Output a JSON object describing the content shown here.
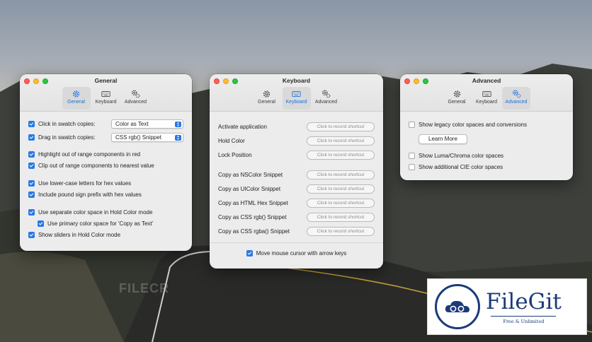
{
  "windows": {
    "general": {
      "title": "General",
      "tabs": [
        {
          "label": "General",
          "icon": "gear-icon",
          "active": true
        },
        {
          "label": "Keyboard",
          "icon": "keyboard-icon",
          "active": false
        },
        {
          "label": "Advanced",
          "icon": "gears-icon",
          "active": false
        }
      ],
      "click_copies_label": "Click in swatch copies:",
      "click_copies_value": "Color as Text",
      "drag_copies_label": "Drag in swatch copies:",
      "drag_copies_value": "CSS rgb() Snippet",
      "options": [
        {
          "label": "Highlight out of range components in red",
          "checked": true
        },
        {
          "label": "Clip out of range components to nearest value",
          "checked": true
        },
        {
          "label": "Use lower-case letters for hex values",
          "checked": true
        },
        {
          "label": "Include pound sign prefix with hex values",
          "checked": true
        },
        {
          "label": "Use separate color space in Hold Color mode",
          "checked": true
        },
        {
          "label": "Use primary color space for 'Copy as Text'",
          "checked": true
        },
        {
          "label": "Show sliders in Hold Color mode",
          "checked": true
        }
      ]
    },
    "keyboard": {
      "title": "Keyboard",
      "tabs": [
        {
          "label": "General",
          "icon": "gear-icon",
          "active": false
        },
        {
          "label": "Keyboard",
          "icon": "keyboard-icon",
          "active": true
        },
        {
          "label": "Advanced",
          "icon": "gears-icon",
          "active": false
        }
      ],
      "shortcut_placeholder": "Click to record shortcut",
      "shortcuts": [
        "Activate application",
        "Hold Color",
        "Lock Position",
        "Copy as NSColor Snippet",
        "Copy as UIColor Snippet",
        "Copy as HTML Hex Snippet",
        "Copy as CSS rgb() Snippet",
        "Copy as CSS rgba() Snippet"
      ],
      "arrow_keys_label": "Move mouse cursor with arrow keys"
    },
    "advanced": {
      "title": "Advanced",
      "tabs": [
        {
          "label": "General",
          "icon": "gear-icon",
          "active": false
        },
        {
          "label": "Keyboard",
          "icon": "keyboard-icon",
          "active": false
        },
        {
          "label": "Advanced",
          "icon": "gears-icon",
          "active": true
        }
      ],
      "legacy_label": "Show legacy color spaces and conversions",
      "learn_more": "Learn More",
      "luma_label": "Show Luma/Chroma color spaces",
      "cie_label": "Show additional CIE color spaces"
    }
  },
  "watermarks": {
    "filecr": "FILECR",
    "filegit_name": "FileGit",
    "filegit_tagline": "Free & Unlimited"
  },
  "colors": {
    "accent": "#2a78e4",
    "filegit_blue": "#1b3a78"
  }
}
